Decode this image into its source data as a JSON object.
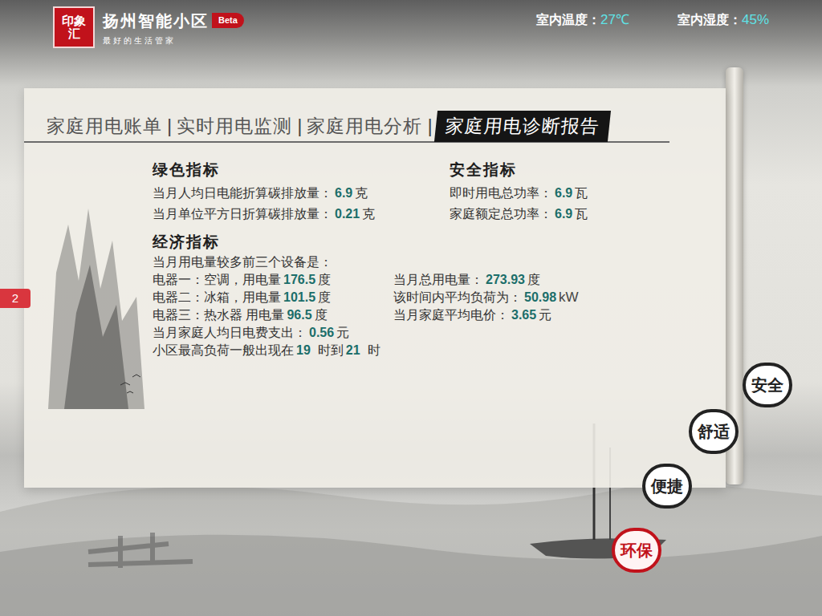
{
  "header": {
    "seal": "印象汇",
    "title": "扬州智能小区",
    "badge": "Beta",
    "subtitle": "最好的生活管家"
  },
  "climate": [
    {
      "label": "室内温度：",
      "value": "27℃"
    },
    {
      "label": "室内湿度：",
      "value": "45%"
    }
  ],
  "tabs": [
    {
      "label": "家庭用电账单",
      "selected": false
    },
    {
      "label": "实时用电监测",
      "selected": false
    },
    {
      "label": "家庭用电分析",
      "selected": false
    },
    {
      "label": "家庭用电诊断报告",
      "selected": true
    }
  ],
  "side_tab": "2",
  "report": {
    "green": {
      "title": "绿色指标",
      "rows": [
        {
          "label": "当月人均日电能折算碳排放量：",
          "value": "6.9",
          "unit": "克"
        },
        {
          "label": "当月单位平方日折算碳排放量：",
          "value": "0.21",
          "unit": "克"
        }
      ]
    },
    "safety": {
      "title": "安全指标",
      "rows": [
        {
          "label": "即时用电总功率：",
          "value": "6.9",
          "unit": "瓦"
        },
        {
          "label": "家庭额定总功率：",
          "value": "6.9",
          "unit": "瓦"
        }
      ]
    },
    "economy": {
      "title": "经济指标",
      "intro": "当月用电量较多前三个设备是：",
      "devices": [
        {
          "label": "电器一：空调，用电量",
          "value": "176.5",
          "unit": "度"
        },
        {
          "label": "电器二：冰箱，用电量",
          "value": "101.5",
          "unit": "度"
        },
        {
          "label": "电器三：热水器 用电量",
          "value": "96.5",
          "unit": "度"
        }
      ],
      "stats": [
        {
          "label": "当月总用电量：",
          "value": "273.93",
          "unit": "度"
        },
        {
          "label": "该时间内平均负荷为：",
          "value": "50.98",
          "unit": "kW"
        },
        {
          "label": "当月家庭平均电价：",
          "value": "3.65",
          "unit": "元"
        }
      ],
      "daily": {
        "label": "当月家庭人均日电费支出：",
        "value": "0.56",
        "unit": "元"
      },
      "peak": {
        "prefix": "小区最高负荷一般出现在",
        "from": "19",
        "mid": "时到",
        "to": "21",
        "suffix": "时"
      }
    }
  },
  "nav": [
    {
      "label": "安全",
      "selected": false
    },
    {
      "label": "舒适",
      "selected": false
    },
    {
      "label": "便捷",
      "selected": false
    },
    {
      "label": "环保",
      "selected": true
    }
  ]
}
